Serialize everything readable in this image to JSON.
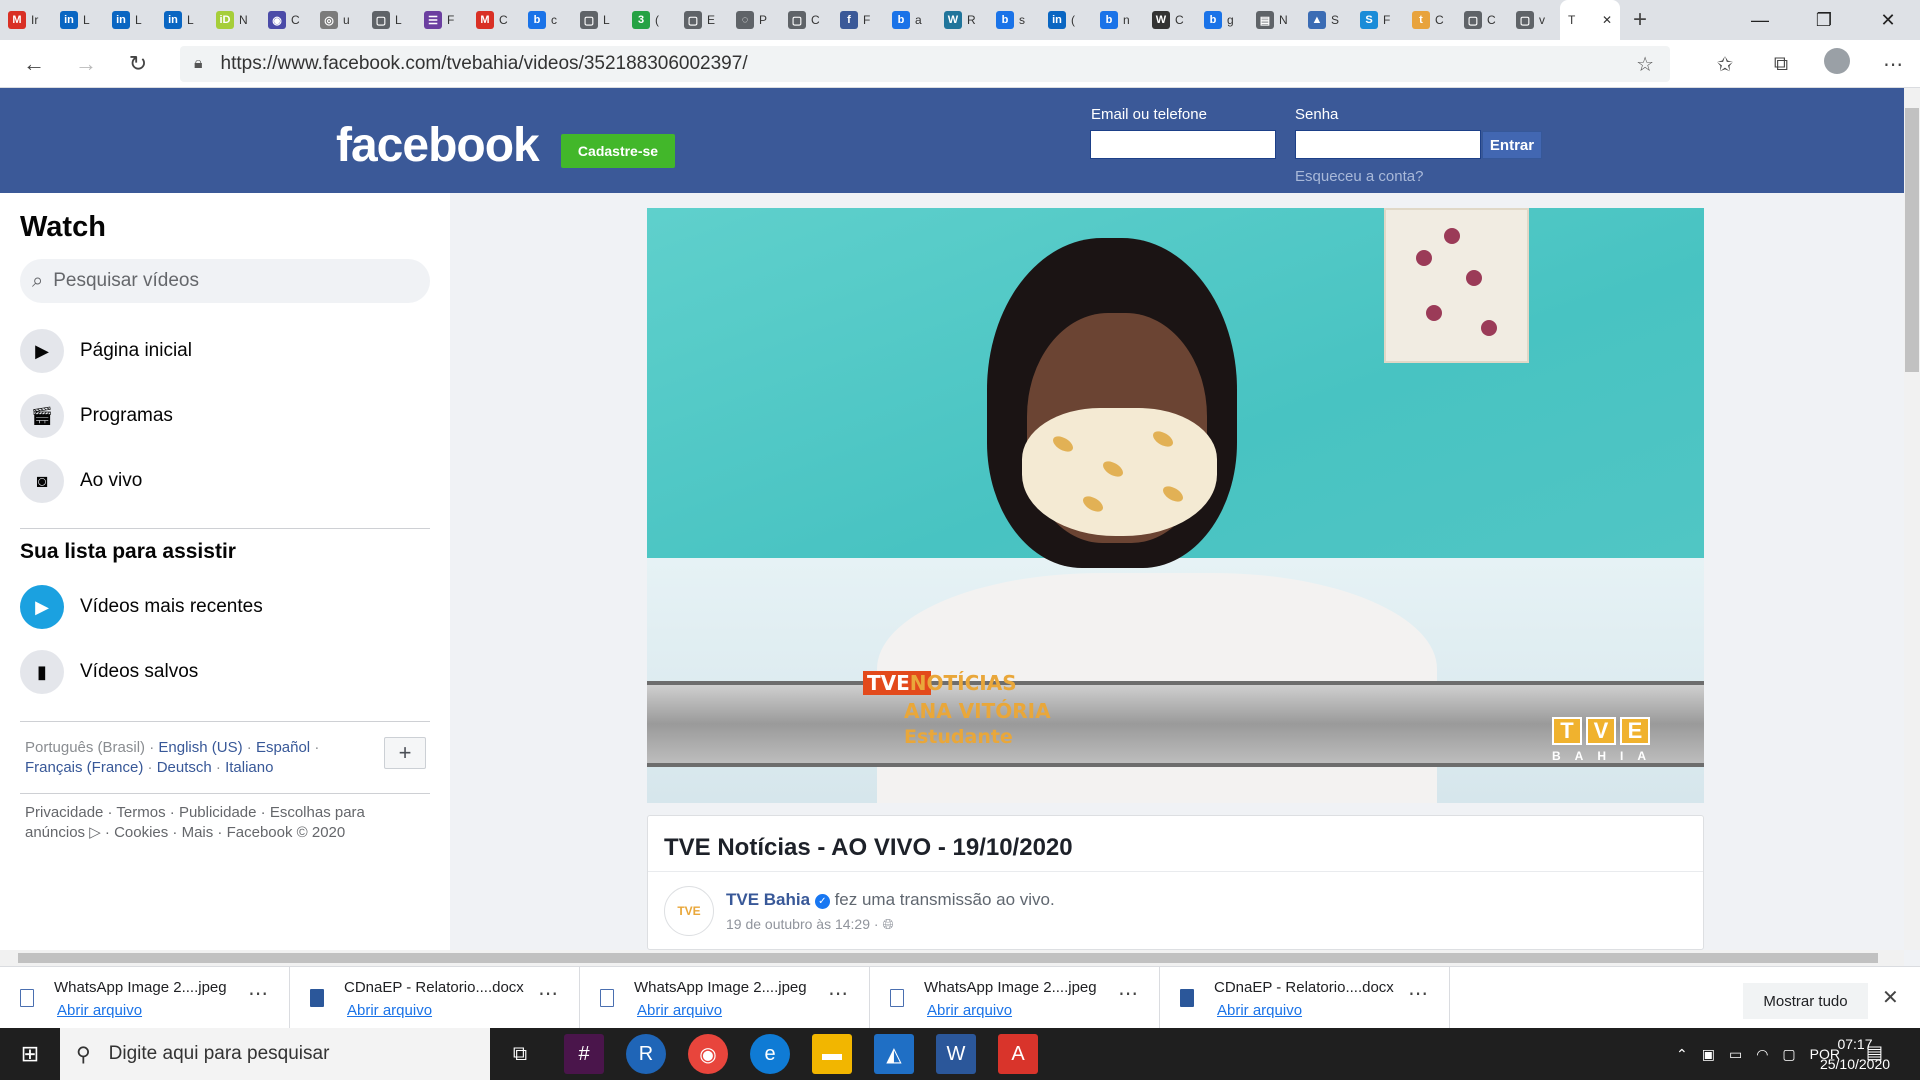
{
  "browser": {
    "tabs": [
      {
        "letter": "M",
        "label": "Ir",
        "color": "#d93025"
      },
      {
        "letter": "in",
        "label": "L",
        "color": "#0a66c2"
      },
      {
        "letter": "in",
        "label": "L",
        "color": "#0a66c2"
      },
      {
        "letter": "in",
        "label": "L",
        "color": "#0a66c2"
      },
      {
        "letter": "iD",
        "label": "N",
        "color": "#a6ce39"
      },
      {
        "letter": "◉",
        "label": "C",
        "color": "#4b4ba8"
      },
      {
        "letter": "◎",
        "label": "u",
        "color": "#7b7b7b"
      },
      {
        "letter": "▢",
        "label": "L",
        "color": "#5f6368"
      },
      {
        "letter": "☰",
        "label": "F",
        "color": "#6b3fa0"
      },
      {
        "letter": "M",
        "label": "C",
        "color": "#d93025"
      },
      {
        "letter": "b",
        "label": "c",
        "color": "#1a73e8"
      },
      {
        "letter": "▢",
        "label": "L",
        "color": "#5f6368"
      },
      {
        "letter": "3",
        "label": "(",
        "color": "#25a244"
      },
      {
        "letter": "▢",
        "label": "E",
        "color": "#5f6368"
      },
      {
        "letter": "◌",
        "label": "P",
        "color": "#5f6368"
      },
      {
        "letter": "▢",
        "label": "C",
        "color": "#5f6368"
      },
      {
        "letter": "f",
        "label": "F",
        "color": "#3b5998"
      },
      {
        "letter": "b",
        "label": "a",
        "color": "#1a73e8"
      },
      {
        "letter": "W",
        "label": "R",
        "color": "#21759b"
      },
      {
        "letter": "b",
        "label": "s",
        "color": "#1a73e8"
      },
      {
        "letter": "in",
        "label": "(",
        "color": "#0a66c2"
      },
      {
        "letter": "b",
        "label": "n",
        "color": "#1a73e8"
      },
      {
        "letter": "W",
        "label": "C",
        "color": "#333333"
      },
      {
        "letter": "b",
        "label": "g",
        "color": "#1a73e8"
      },
      {
        "letter": "▤",
        "label": "N",
        "color": "#5f6368"
      },
      {
        "letter": "▲",
        "label": "S",
        "color": "#3b6cb4"
      },
      {
        "letter": "S",
        "label": "F",
        "color": "#1a8cd8"
      },
      {
        "letter": "t",
        "label": "C",
        "color": "#e8a33d"
      },
      {
        "letter": "▢",
        "label": "C",
        "color": "#5f6368"
      },
      {
        "letter": "▢",
        "label": "v",
        "color": "#5f6368"
      }
    ],
    "active_tab": {
      "label": "T"
    },
    "url": "https://www.facebook.com/tvebahia/videos/352188306002397/"
  },
  "header": {
    "logo": "facebook",
    "signup": "Cadastre-se",
    "email_label": "Email ou telefone",
    "password_label": "Senha",
    "login_button": "Entrar",
    "forgot": "Esqueceu a conta?"
  },
  "sidebar": {
    "title": "Watch",
    "search_placeholder": "Pesquisar vídeos",
    "nav": [
      {
        "label": "Página inicial",
        "icon": "play-screen-icon"
      },
      {
        "label": "Programas",
        "icon": "clapperboard-icon"
      },
      {
        "label": "Ao vivo",
        "icon": "live-camera-icon"
      }
    ],
    "list_title": "Sua lista para assistir",
    "list": [
      {
        "label": "Vídeos mais recentes",
        "icon": "play-circle-icon"
      },
      {
        "label": "Vídeos salvos",
        "icon": "bookmark-icon"
      }
    ],
    "languages": {
      "current": "Português (Brasil)",
      "others": [
        "English (US)",
        "Español",
        "Français (France)",
        "Deutsch",
        "Italiano"
      ]
    },
    "footer": "Privacidade · Termos · Publicidade · Escolhas para anúncios ▷ · Cookies · Mais · Facebook © 2020"
  },
  "video": {
    "brand": "TVE",
    "brand_suffix": "NOTÍCIAS",
    "name": "ANA VITÓRIA",
    "role": "Estudante",
    "logo_letters": [
      "T",
      "V",
      "E"
    ],
    "logo_sub": "BAHIA"
  },
  "post": {
    "title": "TVE Notícias - AO VIVO - 19/10/2020",
    "page_name": "TVE Bahia",
    "action": "fez uma transmissão ao vivo.",
    "date": "19 de outubro às 14:29 ·",
    "avatar_text": "TVE"
  },
  "downloads": [
    {
      "name": "WhatsApp Image 2....jpeg",
      "type": "image"
    },
    {
      "name": "CDnaEP - Relatorio....docx",
      "type": "word"
    },
    {
      "name": "WhatsApp Image 2....jpeg",
      "type": "image"
    },
    {
      "name": "WhatsApp Image 2....jpeg",
      "type": "image"
    },
    {
      "name": "CDnaEP - Relatorio....docx",
      "type": "word"
    }
  ],
  "download_open": "Abrir arquivo",
  "show_all": "Mostrar tudo",
  "taskbar": {
    "search_placeholder": "Digite aqui para pesquisar",
    "language": "POR",
    "time": "07:17",
    "date": "25/10/2020"
  }
}
